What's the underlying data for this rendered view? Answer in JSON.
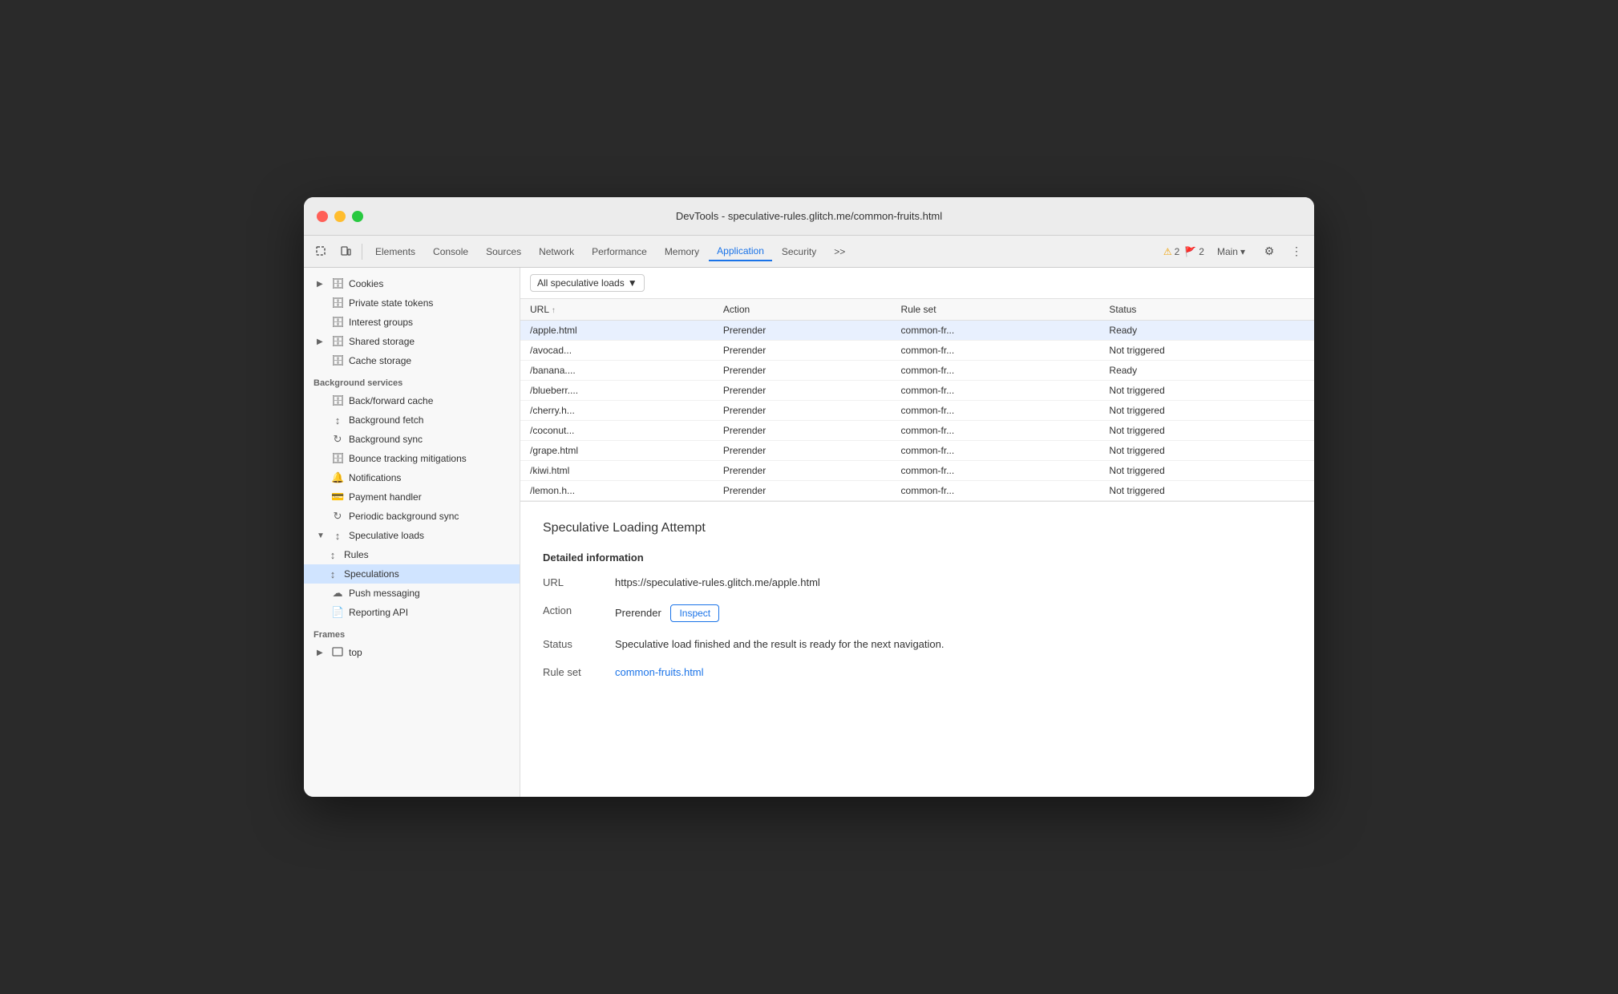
{
  "window": {
    "title": "DevTools - speculative-rules.glitch.me/common-fruits.html"
  },
  "toolbar": {
    "tabs": [
      {
        "label": "Elements",
        "active": false
      },
      {
        "label": "Console",
        "active": false
      },
      {
        "label": "Sources",
        "active": false
      },
      {
        "label": "Network",
        "active": false
      },
      {
        "label": "Performance",
        "active": false
      },
      {
        "label": "Memory",
        "active": false
      },
      {
        "label": "Application",
        "active": true
      },
      {
        "label": "Security",
        "active": false
      }
    ],
    "more_tabs": ">>",
    "warnings": "2",
    "errors": "2",
    "main_label": "Main",
    "settings_icon": "⚙",
    "more_icon": "⋮"
  },
  "sidebar": {
    "storage_items": [
      {
        "label": "Cookies",
        "icon": "▶",
        "has_chevron": true,
        "indent": 0
      },
      {
        "label": "Private state tokens",
        "icon": "🗄",
        "has_chevron": false,
        "indent": 0
      },
      {
        "label": "Interest groups",
        "icon": "🗄",
        "has_chevron": false,
        "indent": 0
      },
      {
        "label": "Shared storage",
        "icon": "▶🗄",
        "has_chevron": true,
        "indent": 0
      },
      {
        "label": "Cache storage",
        "icon": "🗄",
        "has_chevron": false,
        "indent": 0
      }
    ],
    "background_label": "Background services",
    "background_items": [
      {
        "label": "Back/forward cache",
        "icon": "🗄"
      },
      {
        "label": "Background fetch",
        "icon": "↕"
      },
      {
        "label": "Background sync",
        "icon": "↻"
      },
      {
        "label": "Bounce tracking mitigations",
        "icon": "🗄"
      },
      {
        "label": "Notifications",
        "icon": "🔔"
      },
      {
        "label": "Payment handler",
        "icon": "💳"
      },
      {
        "label": "Periodic background sync",
        "icon": "↻"
      },
      {
        "label": "Speculative loads",
        "icon": "↕",
        "expanded": true
      },
      {
        "label": "Rules",
        "icon": "↕",
        "indent": 1
      },
      {
        "label": "Speculations",
        "icon": "↕",
        "indent": 1,
        "active": true
      },
      {
        "label": "Push messaging",
        "icon": "☁"
      },
      {
        "label": "Reporting API",
        "icon": "📄"
      }
    ],
    "frames_label": "Frames",
    "frames_items": [
      {
        "label": "top",
        "icon": "▶🖼"
      }
    ]
  },
  "filter": {
    "label": "All speculative loads",
    "dropdown_icon": "▼"
  },
  "table": {
    "columns": [
      {
        "label": "URL",
        "sortable": true
      },
      {
        "label": "Action"
      },
      {
        "label": "Rule set"
      },
      {
        "label": "Status"
      }
    ],
    "rows": [
      {
        "url": "/apple.html",
        "action": "Prerender",
        "rule_set": "common-fr...",
        "status": "Ready",
        "selected": true
      },
      {
        "url": "/avocad...",
        "action": "Prerender",
        "rule_set": "common-fr...",
        "status": "Not triggered",
        "selected": false
      },
      {
        "url": "/banana....",
        "action": "Prerender",
        "rule_set": "common-fr...",
        "status": "Ready",
        "selected": false
      },
      {
        "url": "/blueberr....",
        "action": "Prerender",
        "rule_set": "common-fr...",
        "status": "Not triggered",
        "selected": false
      },
      {
        "url": "/cherry.h...",
        "action": "Prerender",
        "rule_set": "common-fr...",
        "status": "Not triggered",
        "selected": false
      },
      {
        "url": "/coconut...",
        "action": "Prerender",
        "rule_set": "common-fr...",
        "status": "Not triggered",
        "selected": false
      },
      {
        "url": "/grape.html",
        "action": "Prerender",
        "rule_set": "common-fr...",
        "status": "Not triggered",
        "selected": false
      },
      {
        "url": "/kiwi.html",
        "action": "Prerender",
        "rule_set": "common-fr...",
        "status": "Not triggered",
        "selected": false
      },
      {
        "url": "/lemon.h...",
        "action": "Prerender",
        "rule_set": "common-fr...",
        "status": "Not triggered",
        "selected": false
      }
    ]
  },
  "detail": {
    "title": "Speculative Loading Attempt",
    "section_title": "Detailed information",
    "url_label": "URL",
    "url_value": "https://speculative-rules.glitch.me/apple.html",
    "action_label": "Action",
    "action_value": "Prerender",
    "inspect_label": "Inspect",
    "status_label": "Status",
    "status_value": "Speculative load finished and the result is ready for the next navigation.",
    "rule_set_label": "Rule set",
    "rule_set_link": "common-fruits.html"
  },
  "colors": {
    "active_tab": "#1a73e8",
    "selected_row": "#e8f0fe",
    "link": "#1a73e8",
    "inspect_border": "#1a73e8"
  }
}
